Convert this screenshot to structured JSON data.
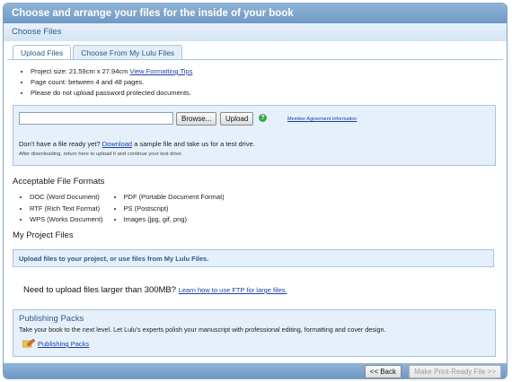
{
  "header": {
    "title": "Choose and arrange your files for the inside of your book"
  },
  "subheader": {
    "title": "Choose Files"
  },
  "tabs": [
    {
      "label": "Upload Files"
    },
    {
      "label": "Choose From My Lulu Files"
    }
  ],
  "info": {
    "size_prefix": "Project size: 21.59cm x 27.94cm ",
    "size_link": "View Formatting Tips",
    "page_count": "Page count: between 4 and 48 pages.",
    "warning": "Please do not upload password protected documents."
  },
  "upload": {
    "browse_label": "Browse...",
    "upload_label": "Upload",
    "help_glyph": "?",
    "agreement_link": "Member Agreement Information",
    "no_file_prefix": "Don't have a file ready yet? ",
    "download_link": "Download",
    "no_file_suffix": " a sample file and take us for a test drive.",
    "after_note": "After downloading, return here to upload it and continue your test drive."
  },
  "formats": {
    "heading": "Acceptable File Formats",
    "col1": [
      "DOC (Word Document)",
      "RTF (Rich Text Format)",
      "WPS (Works Document)"
    ],
    "col2": [
      "PDF (Portable Document Format)",
      "PS (Postscript)",
      "Images (jpg, gif, png)"
    ]
  },
  "project": {
    "heading": "My Project Files",
    "message": "Upload files to your project, or use files from My Lulu Files."
  },
  "ftp": {
    "text": "Need to upload files larger than 300MB? ",
    "link": "Learn how to use FTP for large files."
  },
  "packs": {
    "title": "Publishing Packs",
    "description": "Take your book to the next level. Let Lulu's experts polish your manuscript with professional editing, formatting and cover design.",
    "link": "Publishing Packs",
    "icon": "pencil-icon"
  },
  "footer": {
    "back_label": "<< Back",
    "next_label": "Make Print-Ready File >>"
  },
  "colors": {
    "header": "#7aa3cc",
    "panel": "#e6f0fa",
    "link": "#1a3fa8",
    "help": "#3fa34d"
  }
}
